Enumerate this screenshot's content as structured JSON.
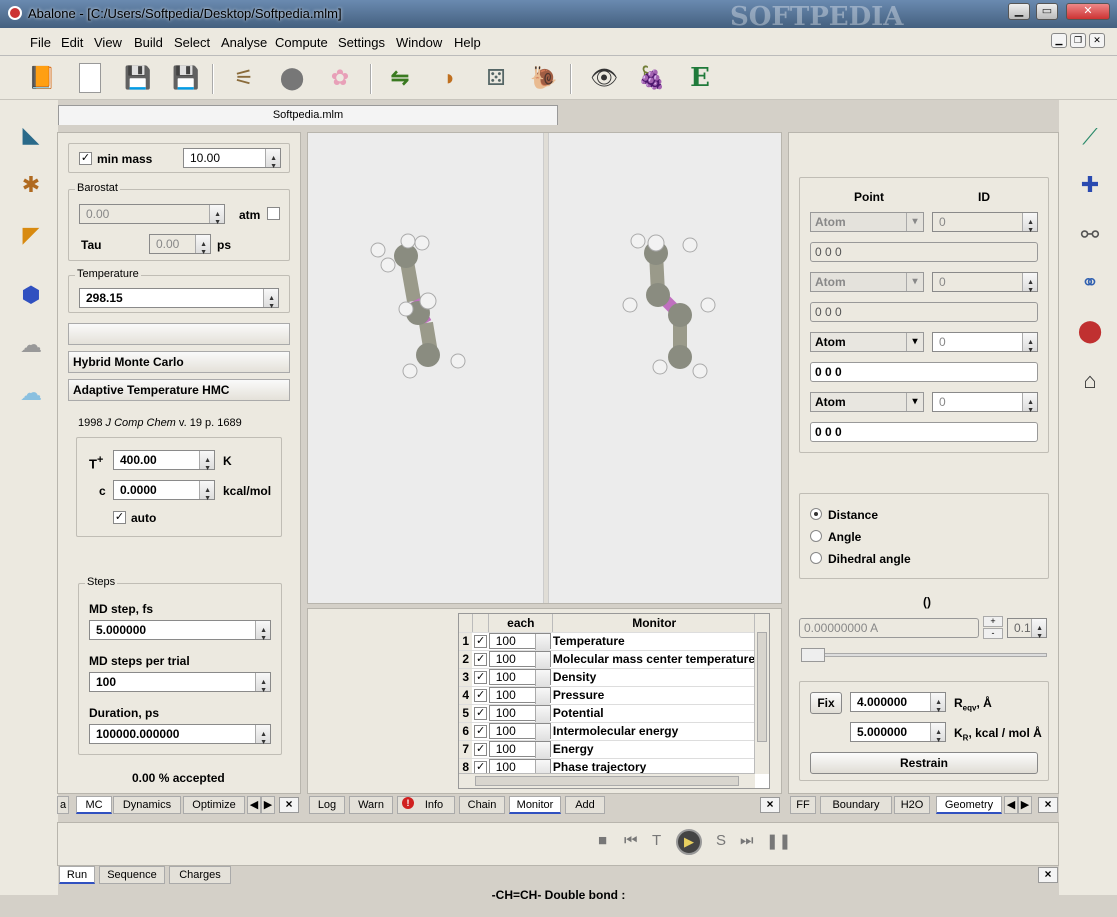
{
  "window": {
    "title": "Abalone - [C:/Users/Softpedia/Desktop/Softpedia.mlm]",
    "watermark": "SOFTPEDIA"
  },
  "menu": [
    "File",
    "Edit",
    "View",
    "Build",
    "Select",
    "Analyse",
    "Compute",
    "Settings",
    "Window",
    "Help"
  ],
  "toolbar": {
    "icons": [
      "open-book-icon",
      "new-document-icon",
      "save-icon",
      "save-all-icon",
      "sequence-icon",
      "spheres-icon",
      "orbitals-icon",
      "exchange-icon",
      "shell-icon",
      "dice-icon",
      "snail-icon",
      "eye-icon",
      "grapes-icon",
      "energy-icon"
    ],
    "energy_letter": "E"
  },
  "document_tab": "Softpedia.mlm",
  "left_panel": {
    "min_mass_label": "min mass",
    "min_mass_value": "10.00",
    "barostat": {
      "label": "Barostat",
      "pressure": "0.00",
      "atm_label": "atm",
      "tau_label": "Tau",
      "tau_value": "0.00",
      "tau_unit": "ps"
    },
    "temperature": {
      "label": "Temperature",
      "value": "298.15"
    },
    "hmc_header": "Hybrid Monte Carlo",
    "athmc_header": "Adaptive Temperature HMC",
    "reference": {
      "year": "1998",
      "journal": "J Comp Chem",
      "rest": "v. 19 p. 1689"
    },
    "tplus_label": "T",
    "tplus_sup": "+",
    "tplus_value": "400.00",
    "tplus_unit": "K",
    "c_label": "c",
    "c_value": "0.0000",
    "c_unit": "kcal/mol",
    "auto_label": "auto",
    "steps": {
      "label": "Steps",
      "md_step_label": "MD step, fs",
      "md_step_value": "5.000000",
      "md_per_trial_label": "MD steps per trial",
      "md_per_trial_value": "100",
      "duration_label": "Duration, ps",
      "duration_value": "100000.000000"
    },
    "accepted": "0.00 % accepted",
    "tabs": [
      "a",
      "MC",
      "Dynamics",
      "Optimize"
    ],
    "active_tab": "MC"
  },
  "monitor": {
    "headers": {
      "each": "each",
      "monitor": "Monitor"
    },
    "rows": [
      {
        "n": "1",
        "each": "100",
        "name": "Temperature"
      },
      {
        "n": "2",
        "each": "100",
        "name": "Molecular mass center temperature"
      },
      {
        "n": "3",
        "each": "100",
        "name": "Density"
      },
      {
        "n": "4",
        "each": "100",
        "name": "Pressure"
      },
      {
        "n": "5",
        "each": "100",
        "name": "Potential"
      },
      {
        "n": "6",
        "each": "100",
        "name": "Intermolecular energy"
      },
      {
        "n": "7",
        "each": "100",
        "name": "Energy"
      },
      {
        "n": "8",
        "each": "100",
        "name": "Phase trajectory"
      }
    ],
    "tabs": [
      "Log",
      "Warn",
      "Info",
      "Chain",
      "Monitor",
      "Add"
    ],
    "active_tab": "Monitor"
  },
  "right_panel": {
    "point_header": "Point",
    "id_header": "ID",
    "points": [
      {
        "atom": "Atom",
        "id": "0",
        "coords": "0 0 0",
        "enabled": false
      },
      {
        "atom": "Atom",
        "id": "0",
        "coords": "0 0 0",
        "enabled": false
      },
      {
        "atom": "Atom",
        "id": "0",
        "coords": "0 0 0",
        "enabled": true
      },
      {
        "atom": "Atom",
        "id": "0",
        "coords": "0 0 0",
        "enabled": true
      }
    ],
    "measures": [
      "Distance",
      "Angle",
      "Dihedral angle"
    ],
    "selected_measure": "Distance",
    "paren": "()",
    "value_field": "0.00000000 A",
    "step_value": "0.10",
    "plus": "+",
    "minus": "-",
    "fix_label": "Fix",
    "req_value": "4.000000",
    "req_label": "R",
    "req_sub": "eqv",
    "req_unit": ", Å",
    "kr_value": "5.000000",
    "kr_label": "K",
    "kr_sub": "R",
    "kr_unit": ", kcal / mol Å",
    "restrain_label": "Restrain",
    "tabs": [
      "FF",
      "Boundary",
      "H2O",
      "Geometry"
    ],
    "active_tab": "Geometry"
  },
  "bottom": {
    "tabs": [
      "Run",
      "Sequence",
      "Charges"
    ],
    "active_tab": "Run",
    "controls": [
      "stop-icon",
      "rewind-icon",
      "T",
      "play-icon",
      "S",
      "step-end-icon",
      "pause-icon"
    ]
  },
  "status": "-CH=CH- Double bond :"
}
